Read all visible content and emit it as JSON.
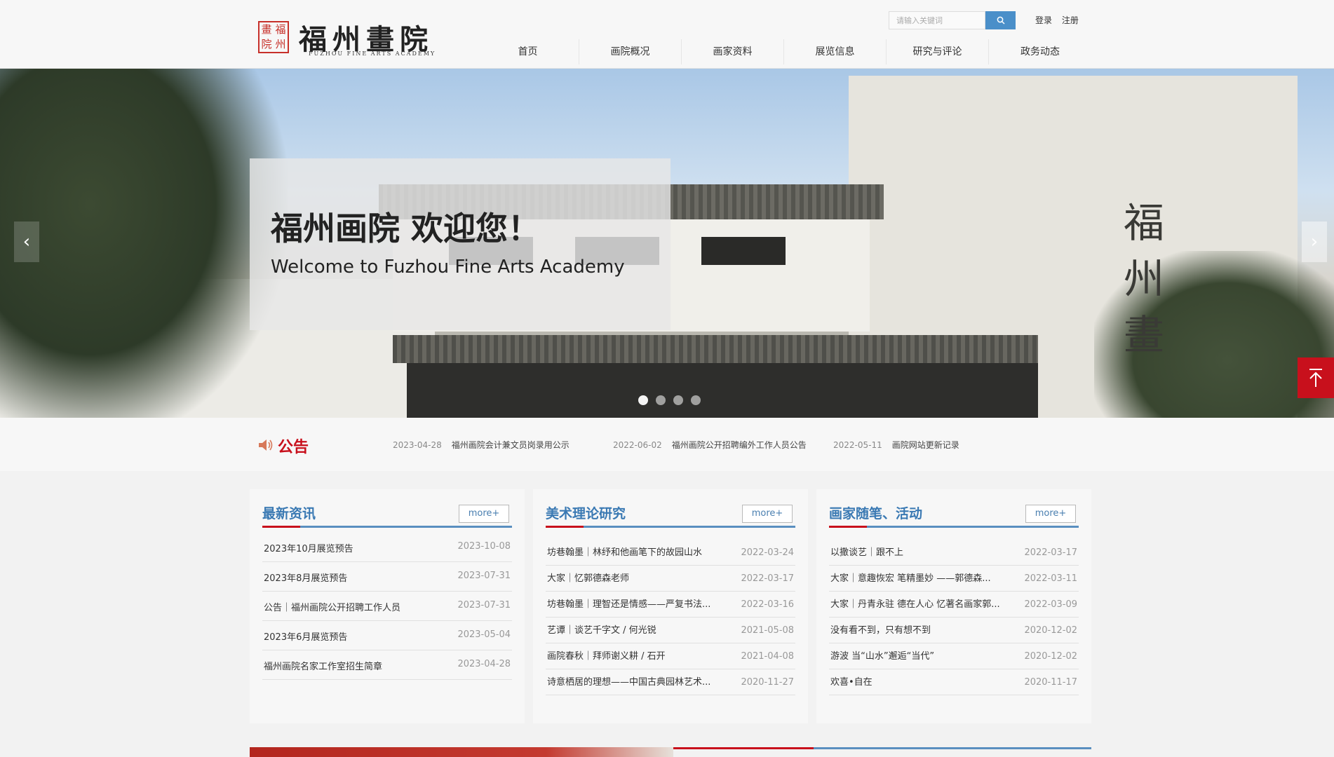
{
  "header": {
    "logo": {
      "seal_chars": [
        "畫",
        "福",
        "院",
        "州"
      ],
      "name_cn": "福州畫院",
      "name_en": "FUZHOU FINE ARTS ACADEMY"
    },
    "search": {
      "placeholder": "请输入关键词",
      "icon": "search-icon"
    },
    "auth": {
      "login": "登录",
      "register": "注册"
    },
    "nav": [
      "首页",
      "画院概况",
      "画家资料",
      "展览信息",
      "研究与评论",
      "政务动态"
    ]
  },
  "banner": {
    "title": "福州画院 欢迎您！",
    "subtitle": "Welcome to Fuzhou Fine Arts Academy",
    "building_calligraphy": [
      "福",
      "州",
      "畫"
    ],
    "slide_count": 4,
    "active_slide": 1,
    "prev_icon": "chevron-left-icon",
    "next_icon": "chevron-right-icon",
    "totop_icon": "arrow-up-to-top-icon"
  },
  "notice": {
    "label": "公告",
    "icon": "speaker-icon",
    "items": [
      {
        "date": "2023-04-28",
        "title": "福州画院会计兼文员岗录用公示"
      },
      {
        "date": "2022-06-02",
        "title": "福州画院公开招聘编外工作人员公告"
      },
      {
        "date": "2022-05-11",
        "title": "画院网站更新记录"
      }
    ]
  },
  "cards": [
    {
      "title": "最新资讯",
      "more": "more+",
      "items": [
        {
          "title": "2023年10月展览预告",
          "date": "2023-10-08"
        },
        {
          "title": "2023年8月展览预告",
          "date": "2023-07-31"
        },
        {
          "title": "公告｜福州画院公开招聘工作人员",
          "date": "2023-07-31"
        },
        {
          "title": "2023年6月展览预告",
          "date": "2023-05-04"
        },
        {
          "title": "福州画院名家工作室招生简章",
          "date": "2023-04-28"
        }
      ]
    },
    {
      "title": "美术理论研究",
      "more": "more+",
      "items": [
        {
          "title": "坊巷翰墨｜林纾和他画笔下的故园山水",
          "date": "2022-03-24"
        },
        {
          "title": "大家｜忆郭德森老师",
          "date": "2022-03-17"
        },
        {
          "title": "坊巷翰墨｜理智还是情感——严复书法...",
          "date": "2022-03-16"
        },
        {
          "title": "艺谭｜谈艺千字文 / 何光锐",
          "date": "2021-05-08"
        },
        {
          "title": "画院春秋｜拜师谢义耕 / 石开",
          "date": "2021-04-08"
        },
        {
          "title": "诗意栖居的理想——中国古典园林艺术...",
          "date": "2020-11-27"
        }
      ]
    },
    {
      "title": "画家随笔、活动",
      "more": "more+",
      "items": [
        {
          "title": "以撒谈艺｜跟不上",
          "date": "2022-03-17"
        },
        {
          "title": "大家｜意趣恢宏 笔精墨妙 ——郭德森...",
          "date": "2022-03-11"
        },
        {
          "title": "大家｜丹青永驻 德在人心 忆著名画家郭...",
          "date": "2022-03-09"
        },
        {
          "title": "没有看不到，只有想不到",
          "date": "2020-12-02"
        },
        {
          "title": "游波 当“山水”邂逅“当代”",
          "date": "2020-12-02"
        },
        {
          "title": "欢喜•自在",
          "date": "2020-11-17"
        }
      ]
    }
  ],
  "colors": {
    "accent_red": "#c8101c",
    "accent_blue": "#3a79b3",
    "search_button": "#4a8fc9"
  }
}
